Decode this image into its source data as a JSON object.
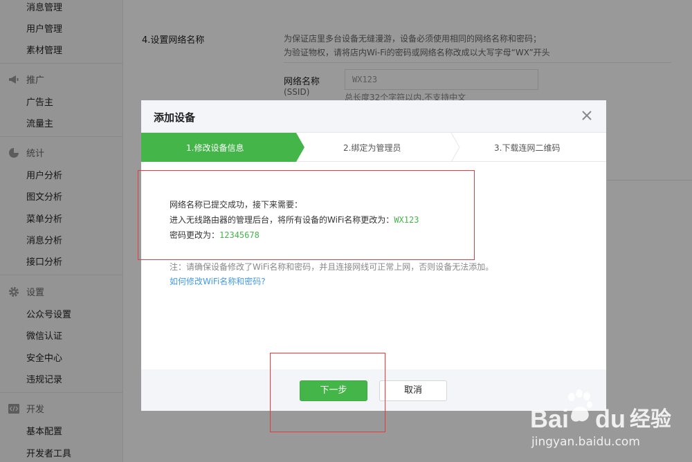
{
  "sidebar": {
    "items": [
      {
        "label": "消息管理"
      },
      {
        "label": "用户管理"
      },
      {
        "label": "素材管理"
      }
    ],
    "sections": [
      {
        "label": "推广",
        "icon": "megaphone-icon",
        "items": [
          {
            "label": "广告主"
          },
          {
            "label": "流量主"
          }
        ]
      },
      {
        "label": "统计",
        "icon": "pie-chart-icon",
        "items": [
          {
            "label": "用户分析"
          },
          {
            "label": "图文分析"
          },
          {
            "label": "菜单分析"
          },
          {
            "label": "消息分析"
          },
          {
            "label": "接口分析"
          }
        ]
      },
      {
        "label": "设置",
        "icon": "gear-icon",
        "items": [
          {
            "label": "公众号设置"
          },
          {
            "label": "微信认证"
          },
          {
            "label": "安全中心"
          },
          {
            "label": "违规记录"
          }
        ]
      },
      {
        "label": "开发",
        "icon": "code-icon",
        "items": [
          {
            "label": "基本配置"
          },
          {
            "label": "开发者工具"
          }
        ]
      }
    ]
  },
  "background": {
    "step_title": "4.设置网络名称",
    "note_line1": "为保证店里多台设备无缝漫游，设备必须使用相同的网络名称和密码；",
    "note_line2": "为验证物权，请将店内Wi-Fi的密码或网络名称改成以大写字母“WX”开头",
    "field_label": "网络名称",
    "field_sub": "(SSID)",
    "field_value": "WX123",
    "field_hint": "总长度32个字符以内,不支持中文"
  },
  "dialog": {
    "title": "添加设备",
    "steps": [
      {
        "label": "1.修改设备信息",
        "active": true
      },
      {
        "label": "2.绑定为管理员",
        "active": false
      },
      {
        "label": "3.下载连网二维码",
        "active": false
      }
    ],
    "message": {
      "line1": "网络名称已提交成功，接下来需要：",
      "line2_prefix": "进入无线路由器的管理后台，将所有设备的WiFi名称更改为：",
      "line2_value": "WX123",
      "line3_prefix": "密码更改为：",
      "line3_value": "12345678"
    },
    "note": "注：请确保设备修改了WiFi名称和密码，并且连接网线可正常上网，否则设备无法添加。",
    "help_link": "如何修改WiFi名称和密码?",
    "buttons": {
      "next": "下一步",
      "cancel": "取消"
    }
  },
  "watermark": {
    "brand": "Bai du 经验",
    "url": "jingyan.baidu.com"
  },
  "colors": {
    "accent": "#44b549",
    "link": "#459ae9",
    "annotation": "#e33b3b"
  }
}
